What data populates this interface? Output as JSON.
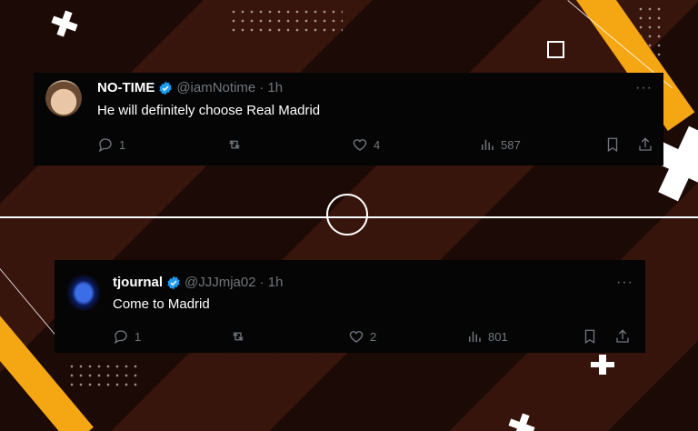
{
  "tweets": [
    {
      "name": "NO-TIME",
      "handle": "@iamNotime",
      "time": "· 1h",
      "text": "He will definitely choose Real Madrid",
      "more": "···",
      "replies": "1",
      "likes": "4",
      "views": "587"
    },
    {
      "name": "tjournal",
      "handle": "@JJJmja02",
      "time": "· 1h",
      "text": "Come to Madrid",
      "more": "···",
      "replies": "1",
      "likes": "2",
      "views": "801"
    }
  ],
  "colors": {
    "accent_yellow": "#f5a613",
    "verified_blue": "#1d9bf0",
    "background": "#1c0a06"
  }
}
